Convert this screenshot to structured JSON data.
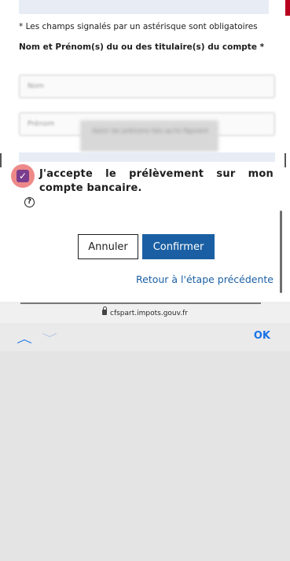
{
  "form": {
    "required_note": "* Les champs signalés par un astérisque sont obligatoires",
    "holder_label": "Nom et Prénom(s) du ou des titulaire(s) du compte *",
    "field1_placeholder": "Nom",
    "field2_placeholder": "Prénom",
    "overlay_text": "Saisir les prénoms tels qu'ils figurent",
    "accept_checkbox": {
      "checked": true,
      "check_glyph": "✓"
    },
    "accept_text": "J'accepte le prélèvement sur mon compte bancaire.",
    "help_glyph": "?"
  },
  "actions": {
    "cancel_label": "Annuler",
    "confirm_label": "Confirmer",
    "back_link": "Retour à l'étape précédente"
  },
  "browser": {
    "url": "cfspart.impots.gouv.fr",
    "lock_icon": "lock-icon"
  },
  "keyboard_toolbar": {
    "prev_glyph": "︿",
    "next_glyph": "﹀",
    "ok_label": "OK"
  },
  "colors": {
    "accent_blue": "#1a5fa3",
    "checkbox_purple": "#7a3d8e",
    "highlight_red": "#e86262",
    "toolbar_blue": "#1a73e8"
  }
}
